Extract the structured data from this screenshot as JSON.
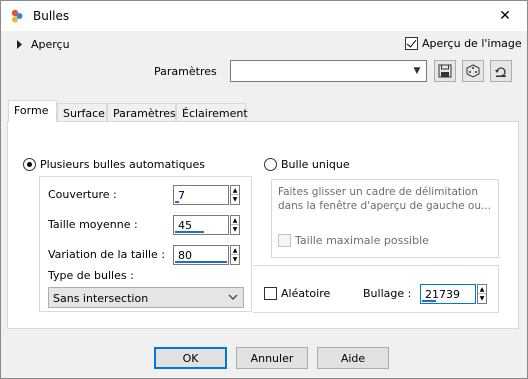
{
  "window": {
    "title": "Bulles",
    "close_glyph": "✕"
  },
  "preview": {
    "label": "Aperçu",
    "image_preview_label": "Aperçu de l'image",
    "image_preview_checked": true
  },
  "params": {
    "label": "Paramètres",
    "value": ""
  },
  "tabs": [
    {
      "label": "Forme",
      "active": true
    },
    {
      "label": "Surface",
      "active": false
    },
    {
      "label": "Paramètres",
      "active": false
    },
    {
      "label": "Éclairement",
      "active": false
    }
  ],
  "forme": {
    "auto_radio_label": "Plusieurs bulles automatiques",
    "single_radio_label": "Bulle unique",
    "coverage": {
      "label": "Couverture :",
      "value": "7",
      "level": 7
    },
    "avg_size": {
      "label": "Taille moyenne :",
      "value": "45",
      "level": 45
    },
    "size_variation": {
      "label": "Variation de la taille :",
      "value": "80",
      "level": 80
    },
    "bubble_type": {
      "label": "Type de bulles :",
      "value": "Sans intersection"
    },
    "hint_text": "Faites glisser un cadre de délimitation dans la fenêtre d'aperçu de gauche ou...",
    "max_size_label": "Taille maximale possible",
    "random_label": "Aléatoire",
    "bubbling": {
      "label": "Bullage :",
      "value": "21739"
    }
  },
  "buttons": {
    "ok": "OK",
    "cancel": "Annuler",
    "help": "Aide"
  },
  "colors": {
    "accent": "#0078d7",
    "slider": "#1f6fc2"
  }
}
